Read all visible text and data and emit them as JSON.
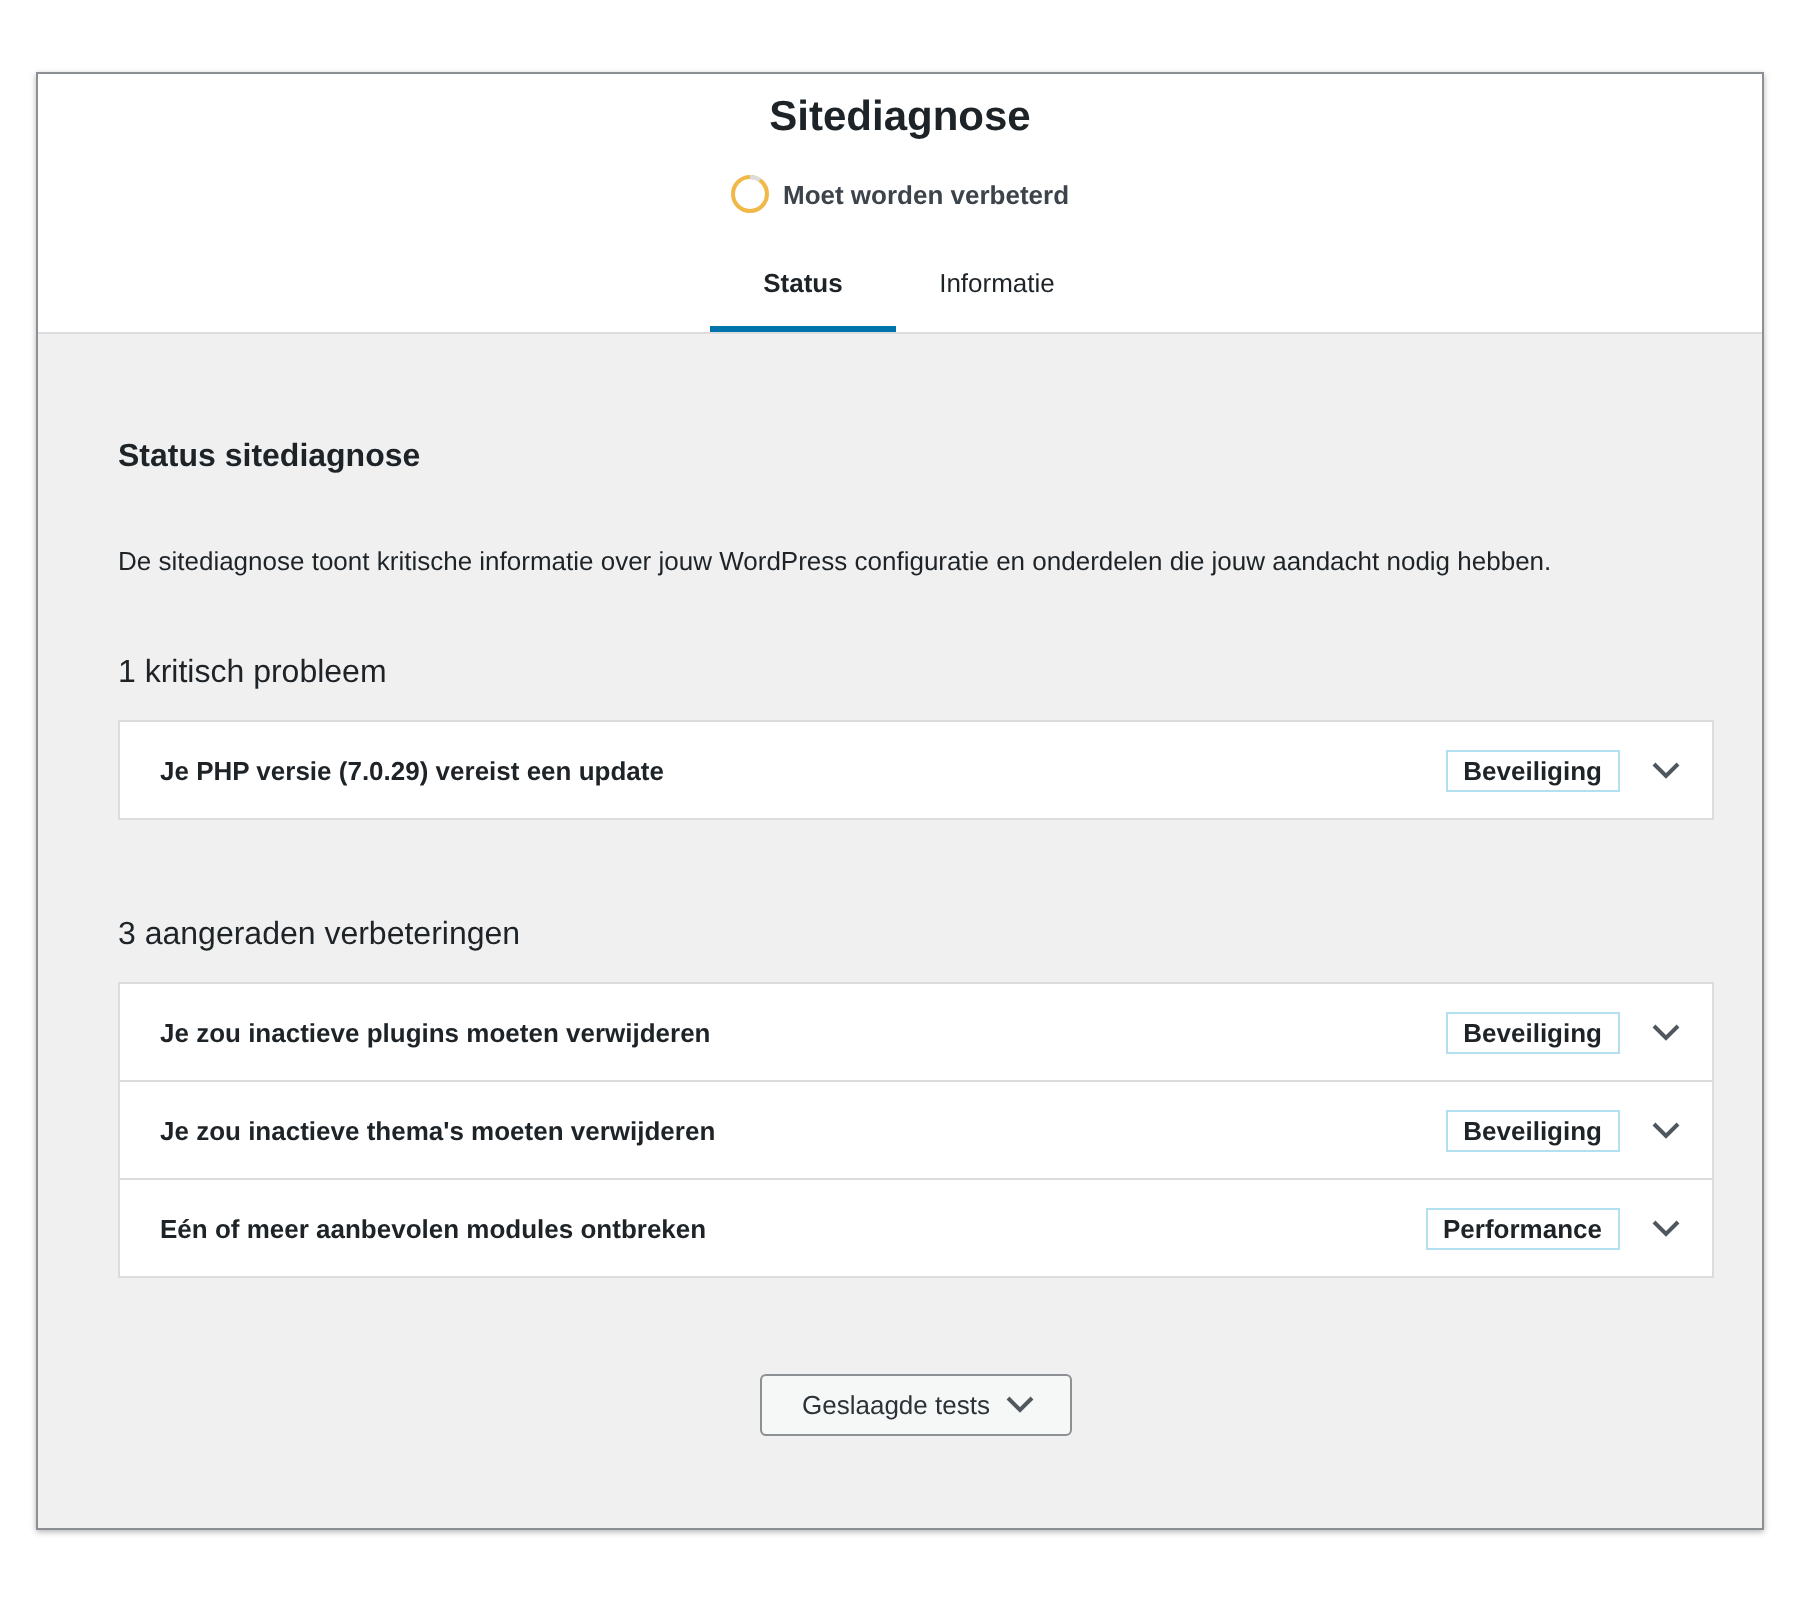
{
  "header": {
    "title": "Sitediagnose",
    "status": "Moet worden verbeterd"
  },
  "tabs": [
    {
      "label": "Status",
      "selected": true
    },
    {
      "label": "Informatie",
      "selected": false
    }
  ],
  "section": {
    "title": "Status sitediagnose",
    "description": "De sitediagnose toont kritische informatie over jouw WordPress configuratie en onderdelen die jouw aandacht nodig hebben."
  },
  "groups": [
    {
      "heading": "1 kritisch probleem",
      "items": [
        {
          "title": "Je PHP versie (7.0.29) vereist een update",
          "badge": "Beveiliging",
          "expanded": false
        }
      ]
    },
    {
      "heading": "3 aangeraden verbeteringen",
      "items": [
        {
          "title": "Je zou inactieve plugins moeten verwijderen",
          "badge": "Beveiliging",
          "expanded": false
        },
        {
          "title": "Je zou inactieve thema's moeten verwijderen",
          "badge": "Beveiliging",
          "expanded": false
        },
        {
          "title": "Eén of meer aanbevolen modules ontbreken",
          "badge": "Performance",
          "expanded": false
        }
      ]
    }
  ],
  "passed_button": {
    "label": "Geslaagde tests",
    "expanded": false
  }
}
